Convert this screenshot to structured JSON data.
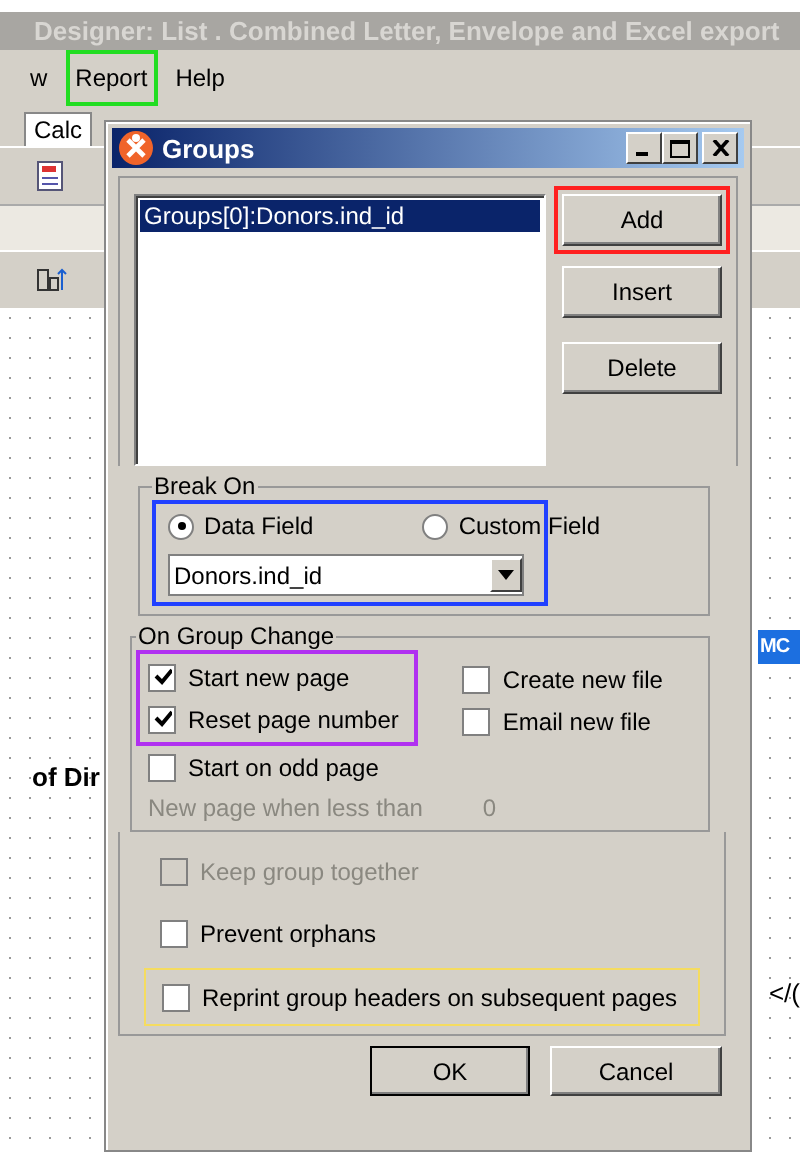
{
  "window": {
    "title": "Designer: List . Combined Letter, Envelope and Excel export"
  },
  "menu": [
    {
      "label": "w"
    },
    {
      "label": "Report",
      "color": "#22dd22"
    },
    {
      "label": "Help"
    }
  ],
  "tabs": [
    {
      "label": "Calc",
      "selected": true
    }
  ],
  "background_texts": [
    {
      "text": "of Dir",
      "kind": "bold"
    },
    {
      "text": "MC",
      "kind": "band"
    },
    {
      "text": "</(",
      "kind": "plain"
    }
  ],
  "dialog": {
    "title": "Groups",
    "groups_list": [
      {
        "label": "Groups[0]:Donors.ind_id",
        "selected": true
      }
    ],
    "buttons": [
      {
        "label": "Add",
        "color": "#ff2020"
      },
      {
        "label": "Insert"
      },
      {
        "label": "Delete"
      }
    ],
    "break_on": {
      "title": "Break On",
      "color": "#2040ff",
      "radios": [
        {
          "label": "Data Field",
          "selected": true
        },
        {
          "label": "Custom Field",
          "selected": false
        }
      ],
      "field_value": "Donors.ind_id"
    },
    "on_group_change": {
      "title": "On Group Change",
      "color": "#b030f0",
      "highlighted_options": [
        {
          "label": "Start new page",
          "checked": true,
          "disabled": false
        },
        {
          "label": "Reset page number",
          "checked": true,
          "disabled": false
        }
      ],
      "options": [
        {
          "label": "Start on odd page",
          "checked": false,
          "disabled": false
        }
      ],
      "right_options": [
        {
          "label": "Create new file",
          "checked": false,
          "disabled": false
        },
        {
          "label": "Email new file",
          "checked": false,
          "disabled": false
        }
      ],
      "threshold": {
        "label": "New page when less than",
        "value": "0",
        "disabled": true
      }
    },
    "options": [
      {
        "label": "Keep group together",
        "checked": false,
        "disabled": true
      },
      {
        "label": "Prevent orphans",
        "checked": false,
        "disabled": false
      },
      {
        "label": "Reprint group headers on subsequent pages",
        "checked": false,
        "disabled": false,
        "color": "#f5dc60"
      }
    ],
    "footer_buttons": [
      {
        "label": "OK",
        "default": true
      },
      {
        "label": "Cancel",
        "default": false
      }
    ]
  }
}
